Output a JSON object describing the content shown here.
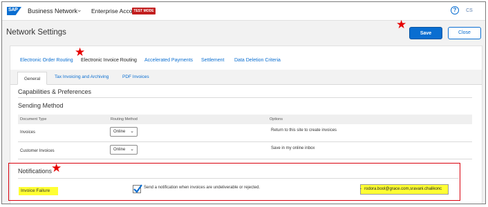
{
  "topbar": {
    "logo_text": "SAP",
    "product": "Business Network",
    "account": "Enterprise Account",
    "test_mode_badge": "TEST MODE",
    "avatar_initials": "CS"
  },
  "header": {
    "title": "Network Settings",
    "save_label": "Save",
    "close_label": "Close"
  },
  "tabs": [
    {
      "label": "Electronic Order Routing",
      "active": false
    },
    {
      "label": "Electronic Invoice Routing",
      "active": true
    },
    {
      "label": "Accelerated Payments",
      "active": false
    },
    {
      "label": "Settlement",
      "active": false
    },
    {
      "label": "Data Deletion Criteria",
      "active": false
    }
  ],
  "subtabs": [
    {
      "label": "General",
      "active": true
    },
    {
      "label": "Tax Invoicing and Archiving",
      "active": false
    },
    {
      "label": "PDF Invoices",
      "active": false
    }
  ],
  "sections": {
    "capabilities": "Capabilities & Preferences",
    "sending_method": "Sending Method",
    "notifications": "Notifications"
  },
  "table": {
    "headers": [
      "Document Type",
      "Routing Method",
      "Options"
    ],
    "rows": [
      {
        "doc_type": "Invoices",
        "routing": "Online",
        "options": "Return to this site to create invoices"
      },
      {
        "doc_type": "Customer Invoices",
        "routing": "Online",
        "options": "Save in my online inbox"
      }
    ]
  },
  "notifications": {
    "row_label": "Invoice Failure",
    "checkbox_checked": true,
    "checkbox_text": "Send a notification when invoices are undeliverable or rejected.",
    "email_value": "rodora.bool@grace.com,sravani.chalikonc"
  },
  "colors": {
    "accent": "#0a6ed1",
    "annotation_red": "#e60000",
    "highlight_yellow": "#ffff33",
    "test_mode_red": "#c21e1e"
  }
}
